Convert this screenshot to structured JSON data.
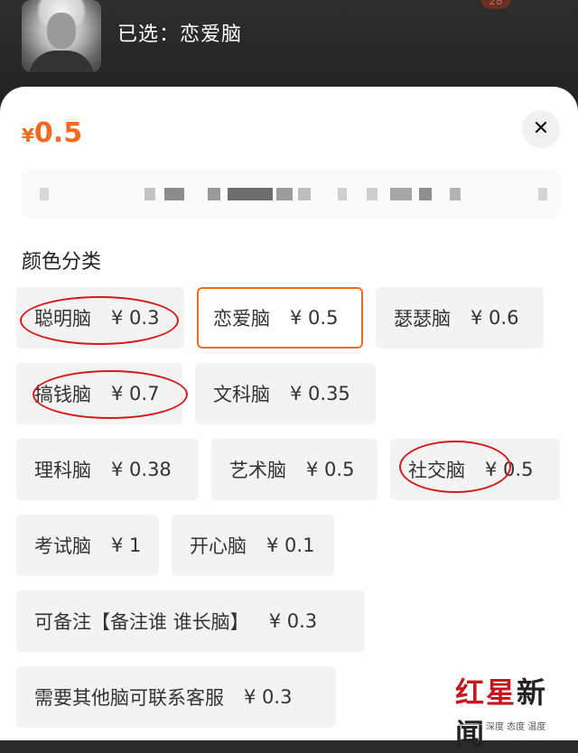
{
  "header": {
    "selected_text": "已选：恋爱脑",
    "badge": "28"
  },
  "sheet": {
    "price_symbol": "¥",
    "price_value": "0.5",
    "close_label": "✕",
    "section_title": "颜色分类",
    "options": [
      {
        "label": "聪明脑",
        "price": "¥ 0.3"
      },
      {
        "label": "恋爱脑",
        "price": "¥ 0.5"
      },
      {
        "label": "瑟瑟脑",
        "price": "¥ 0.6"
      },
      {
        "label": "搞钱脑",
        "price": "¥ 0.7"
      },
      {
        "label": "文科脑",
        "price": "¥ 0.35"
      },
      {
        "label": "理科脑",
        "price": "¥ 0.38"
      },
      {
        "label": "艺术脑",
        "price": "¥ 0.5"
      },
      {
        "label": "社交脑",
        "price": "¥ 0.5"
      },
      {
        "label": "考试脑",
        "price": "¥ 1"
      },
      {
        "label": "开心脑",
        "price": "¥ 0.1"
      },
      {
        "label": "可备注【备注谁 谁长脑】",
        "price": "¥ 0.3"
      },
      {
        "label": "需要其他脑可联系客服",
        "price": "¥ 0.3"
      }
    ],
    "selected_index": 1
  },
  "colors": {
    "accent": "#f46a1f",
    "annotation_red": "#d21b1b"
  },
  "watermark": {
    "logo_text": "红星新闻",
    "tagline": "深度 态度 温度"
  }
}
